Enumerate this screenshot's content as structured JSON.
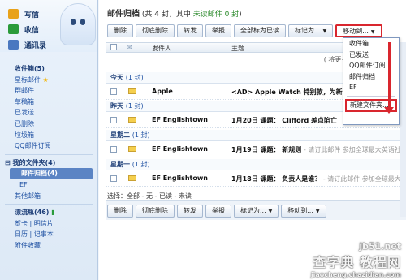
{
  "sidebar": {
    "top": [
      {
        "label": "写信",
        "icon": "pencil-icon",
        "color": "#e8a21a"
      },
      {
        "label": "收信",
        "icon": "inbox-icon",
        "color": "#2a9b3a"
      },
      {
        "label": "通讯录",
        "icon": "contacts-icon",
        "color": "#4a78c0"
      }
    ],
    "inbox": "收件箱(5)",
    "starred": "星标邮件",
    "folders": [
      "群邮件",
      "草稿箱",
      "已发送",
      "已删除",
      "垃圾箱",
      "QQ邮件订阅"
    ],
    "my_folders": "我的文件夹(4)",
    "my_folder_items": [
      "邮件归档(4)",
      "EF",
      "其他邮箱"
    ],
    "drift": "漂流瓶(46)",
    "misc": [
      [
        "贺卡",
        "明信片"
      ],
      [
        "日历",
        "记事本"
      ]
    ],
    "attachments": "附件收藏"
  },
  "header": {
    "title": "邮件归档",
    "summary_pre": "(共 4 封，其中",
    "unread": "未读邮件 0 封",
    "summary_post": ")"
  },
  "toolbar": {
    "delete": "删除",
    "perm_delete": "彻底删除",
    "forward": "转发",
    "report": "举报",
    "mark_all_read": "全部标为已读",
    "mark_as": "标记为...",
    "move_to": "移动到..."
  },
  "columns": {
    "sender": "发件人",
    "subject": "主题"
  },
  "notice": "( 将更多邮件自...",
  "groups": [
    {
      "label": "今天",
      "count": "(1 封)"
    },
    {
      "label": "昨天",
      "count": "(1 封)"
    },
    {
      "label": "星期二",
      "count": "(1 封)"
    },
    {
      "label": "星期一",
      "count": "(1 封)"
    }
  ],
  "emails": [
    {
      "sender": "Apple",
      "subject": "<AD> Apple Watch 特别款，为新",
      "preview": ""
    },
    {
      "sender": "EF Englishtown",
      "subject": "1月20日 课题： Clifford 差点陷亡",
      "preview": ""
    },
    {
      "sender": "EF Englishtown",
      "subject": "1月19日 课题： 新规则",
      "preview": " - 请订此邮件 参加全球最大英语社"
    },
    {
      "sender": "EF Englishtown",
      "subject": "1月18日 课题： 负责人是谁？",
      "preview": " - 请订此邮件 参加全球最大英语社"
    }
  ],
  "select_line": "选择：全部 - 无 - 已读 - 未读",
  "menu": {
    "items": [
      "收件箱",
      "已发送",
      "QQ邮件订阅",
      "邮件归档",
      "EF"
    ],
    "new_folder": "新建文件夹..."
  },
  "watermark": {
    "line1": "jb51.net",
    "line2": "查字典 教程网",
    "line3": "jiaocheng.chazidian.com"
  },
  "colors": {
    "accent": "#5b84c4",
    "highlight": "#d9262e",
    "unread": "#2c8a2c"
  }
}
